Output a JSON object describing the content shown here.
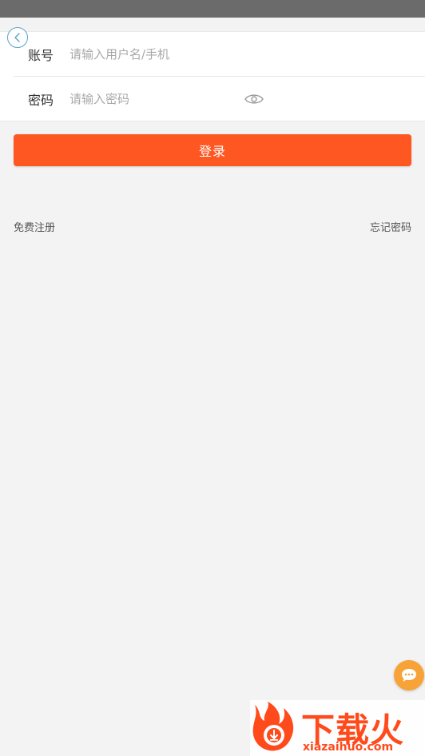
{
  "login_form": {
    "account_label": "账号",
    "account_placeholder": "请输入用户名/手机",
    "password_label": "密码",
    "password_placeholder": "请输入密码",
    "login_button": "登录"
  },
  "links": {
    "register": "免费注册",
    "forgot_password": "忘记密码"
  },
  "icons": {
    "back": "back-icon",
    "password_visibility": "eye-icon",
    "chat": "chat-bubble-icon"
  },
  "watermark": {
    "brand": "下载火",
    "domain": "xiazaihuo.com"
  },
  "colors": {
    "accent": "#ff5722",
    "background": "#f3f3f3",
    "chat_fab": "#f7a338"
  }
}
